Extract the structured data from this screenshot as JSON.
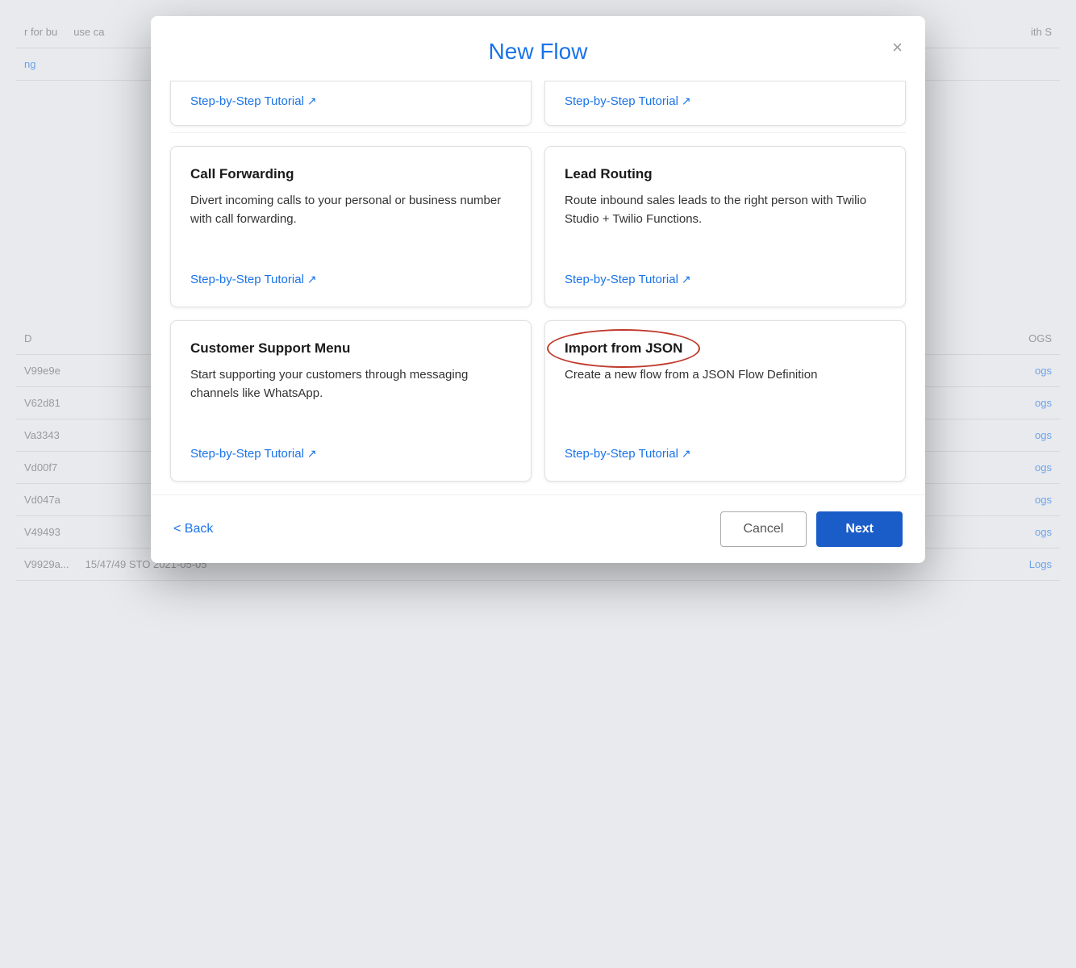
{
  "modal": {
    "title": "New Flow",
    "close_label": "×"
  },
  "partial_cards": [
    {
      "id": "card-partial-left",
      "link_label": "Step-by-Step Tutorial",
      "link_arrow": "↗"
    },
    {
      "id": "card-partial-right",
      "link_label": "Step-by-Step Tutorial",
      "link_arrow": "↗"
    }
  ],
  "cards": [
    {
      "id": "call-forwarding",
      "title": "Call Forwarding",
      "description": "Divert incoming calls to your personal or business number with call forwarding.",
      "link_label": "Step-by-Step Tutorial",
      "link_arrow": "↗"
    },
    {
      "id": "lead-routing",
      "title": "Lead Routing",
      "description": "Route inbound sales leads to the right person with Twilio Studio + Twilio Functions.",
      "link_label": "Step-by-Step Tutorial",
      "link_arrow": "↗"
    },
    {
      "id": "customer-support",
      "title": "Customer Support Menu",
      "description": "Start supporting your customers through messaging channels like WhatsApp.",
      "link_label": "Step-by-Step Tutorial",
      "link_arrow": "↗"
    },
    {
      "id": "import-json",
      "title": "Import from JSON",
      "description": "Create a new flow from a JSON Flow Definition",
      "link_label": "Step-by-Step Tutorial",
      "link_arrow": "↗",
      "highlighted": true
    }
  ],
  "footer": {
    "back_label": "< Back",
    "cancel_label": "Cancel",
    "next_label": "Next"
  },
  "background": {
    "rows": [
      {
        "id": "r1",
        "col1": "r for bu",
        "col2": "use ca",
        "col3": ""
      },
      {
        "id": "r2",
        "col1": "ng",
        "col2": "",
        "col3": ""
      },
      {
        "id": "r3",
        "col1": "D",
        "col2": "",
        "col3": "OGS"
      },
      {
        "id": "r4",
        "col1": "V99e9e",
        "col2": "",
        "col3": "ogs"
      },
      {
        "id": "r5",
        "col1": "V62d81",
        "col2": "",
        "col3": "ogs"
      },
      {
        "id": "r6",
        "col1": "Va3343",
        "col2": "",
        "col3": "ogs"
      },
      {
        "id": "r7",
        "col1": "Vd00f7",
        "col2": "",
        "col3": "ogs"
      },
      {
        "id": "r8",
        "col1": "Vd047a",
        "col2": "",
        "col3": "ogs"
      },
      {
        "id": "r9",
        "col1": "V49493",
        "col2": "",
        "col3": "ogs"
      },
      {
        "id": "r10",
        "col1": "V9929a...",
        "col2": "15/47/49 STO 2021-05-05",
        "col3": "Logs"
      }
    ]
  }
}
